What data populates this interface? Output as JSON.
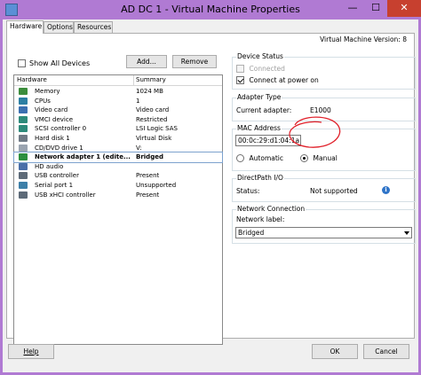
{
  "window": {
    "title": "AD DC 1 - Virtual Machine Properties",
    "min_glyph": "—",
    "max_glyph": "☐",
    "close_glyph": "✕"
  },
  "tabs": [
    {
      "label": "Hardware",
      "active": true
    },
    {
      "label": "Options",
      "active": false
    },
    {
      "label": "Resources",
      "active": false
    }
  ],
  "vm_version": "Virtual Machine Version: 8",
  "toolbar": {
    "show_all_label": "Show All Devices",
    "show_all_checked": false,
    "add_label": "Add...",
    "remove_label": "Remove"
  },
  "hardware_table": {
    "columns": [
      "Hardware",
      "Summary"
    ],
    "rows": [
      {
        "icon": "memory-icon",
        "name": "Memory",
        "summary": "1024 MB",
        "selected": false
      },
      {
        "icon": "cpu-icon",
        "name": "CPUs",
        "summary": "1",
        "selected": false
      },
      {
        "icon": "monitor-icon",
        "name": "Video card",
        "summary": "Video card",
        "selected": false
      },
      {
        "icon": "chip-icon",
        "name": "VMCI device",
        "summary": "Restricted",
        "selected": false
      },
      {
        "icon": "chip-icon",
        "name": "SCSI controller 0",
        "summary": "LSI Logic SAS",
        "selected": false
      },
      {
        "icon": "hard-disk-icon",
        "name": "Hard disk 1",
        "summary": "Virtual Disk",
        "selected": false
      },
      {
        "icon": "cd-dvd-icon",
        "name": "CD/DVD drive 1",
        "summary": "V:",
        "selected": false
      },
      {
        "icon": "network-adapter-icon",
        "name": "Network adapter 1 (edite...",
        "summary": "Bridged",
        "selected": true
      },
      {
        "icon": "speaker-icon",
        "name": "HD audio",
        "summary": "",
        "selected": false
      },
      {
        "icon": "usb-icon",
        "name": "USB controller",
        "summary": "Present",
        "selected": false
      },
      {
        "icon": "serial-port-icon",
        "name": "Serial port 1",
        "summary": "Unsupported",
        "selected": false
      },
      {
        "icon": "usb-icon",
        "name": "USB xHCI controller",
        "summary": "Present",
        "selected": false
      }
    ]
  },
  "device_status": {
    "legend": "Device Status",
    "connected_label": "Connected",
    "connected_checked": false,
    "connected_disabled": true,
    "power_on_label": "Connect at power on",
    "power_on_checked": true
  },
  "adapter_type": {
    "legend": "Adapter Type",
    "current_label": "Current adapter:",
    "current_value": "E1000"
  },
  "mac_address": {
    "legend": "MAC Address",
    "value": "00:0c:29:d1:04:1a",
    "automatic_label": "Automatic",
    "manual_label": "Manual",
    "selected": "manual",
    "annotation_color": "#e0202a"
  },
  "directpath": {
    "legend": "DirectPath I/O",
    "status_label": "Status:",
    "status_value": "Not supported",
    "info_glyph": "i"
  },
  "network_connection": {
    "legend": "Network Connection",
    "network_label": "Network label:",
    "selected_value": "Bridged"
  },
  "footer": {
    "help_label": "Help",
    "ok_label": "OK",
    "cancel_label": "Cancel"
  },
  "colors": {
    "title_bar": "#b07ad3",
    "close_button": "#c7402f",
    "selection_outline": "#7da2ce",
    "info_icon": "#2f74c8"
  }
}
